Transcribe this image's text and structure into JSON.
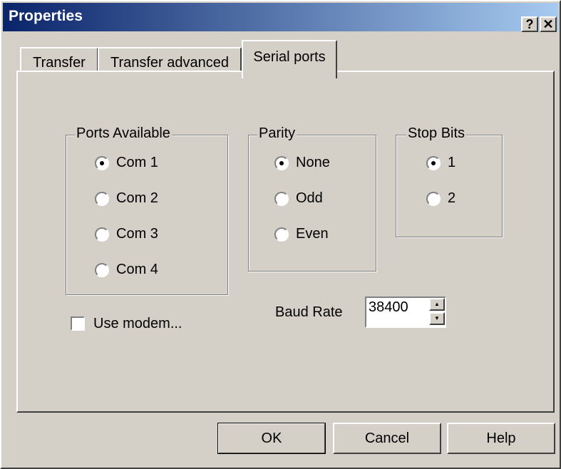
{
  "window": {
    "title": "Properties",
    "help_label": "?",
    "close_label": "✕"
  },
  "tabs": [
    {
      "label": "Transfer"
    },
    {
      "label": "Transfer advanced"
    },
    {
      "label": "Serial ports"
    }
  ],
  "ports": {
    "title": "Ports Available",
    "options": [
      "Com 1",
      "Com 2",
      "Com 3",
      "Com 4"
    ],
    "selected": "Com 1"
  },
  "parity": {
    "title": "Parity",
    "options": [
      "None",
      "Odd",
      "Even"
    ],
    "selected": "None"
  },
  "stopbits": {
    "title": "Stop Bits",
    "options": [
      "1",
      "2"
    ],
    "selected": "1"
  },
  "modem": {
    "label": "Use modem...",
    "checked": false
  },
  "baud": {
    "label": "Baud Rate",
    "value": "38400"
  },
  "buttons": {
    "ok": "OK",
    "cancel": "Cancel",
    "help": "Help"
  }
}
